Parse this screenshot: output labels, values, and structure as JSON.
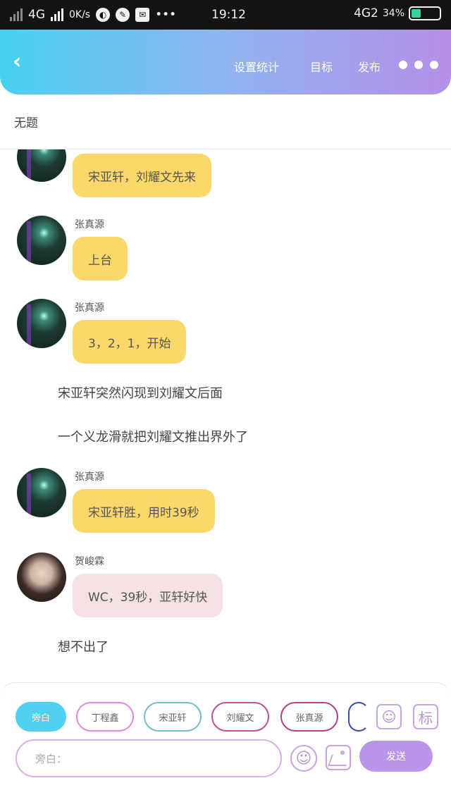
{
  "status_bar": {
    "network": "4G",
    "speed": "0K/s",
    "time": "19:12",
    "network_right": "4G2",
    "battery_percent": "34%",
    "battery_level": 0.34
  },
  "header": {
    "links": [
      "设置统计",
      "目标",
      "发布"
    ]
  },
  "subtitle": "无题",
  "messages": [
    {
      "type": "bubble",
      "name": "",
      "text": "宋亚轩，刘耀文先来",
      "color": "#fcd86a"
    },
    {
      "type": "bubble",
      "name": "张真源",
      "text": "上台",
      "color": "#fcd86a"
    },
    {
      "type": "bubble",
      "name": "张真源",
      "text": "3，2，1，开始",
      "color": "#fcd86a"
    },
    {
      "type": "narration",
      "text": "宋亚轩突然闪现到刘耀文后面"
    },
    {
      "type": "narration",
      "text": "一个义龙滑就把刘耀文推出界外了"
    },
    {
      "type": "bubble",
      "name": "张真源",
      "text": "宋亚轩胜，用时39秒",
      "color": "#fcd86a"
    },
    {
      "type": "bubble",
      "name": "贺峻霖",
      "text": "WC，39秒，亚轩好快",
      "color": "#f3e1e3"
    },
    {
      "type": "narration",
      "text": "想不出了"
    }
  ],
  "chips": [
    "旁白",
    "丁程鑫",
    "宋亚轩",
    "刘耀文",
    "张真源",
    ""
  ],
  "tools": {
    "person_icon": "person-icon",
    "tag_label": "标"
  },
  "input": {
    "placeholder": "旁白："
  },
  "send_label": "发送"
}
